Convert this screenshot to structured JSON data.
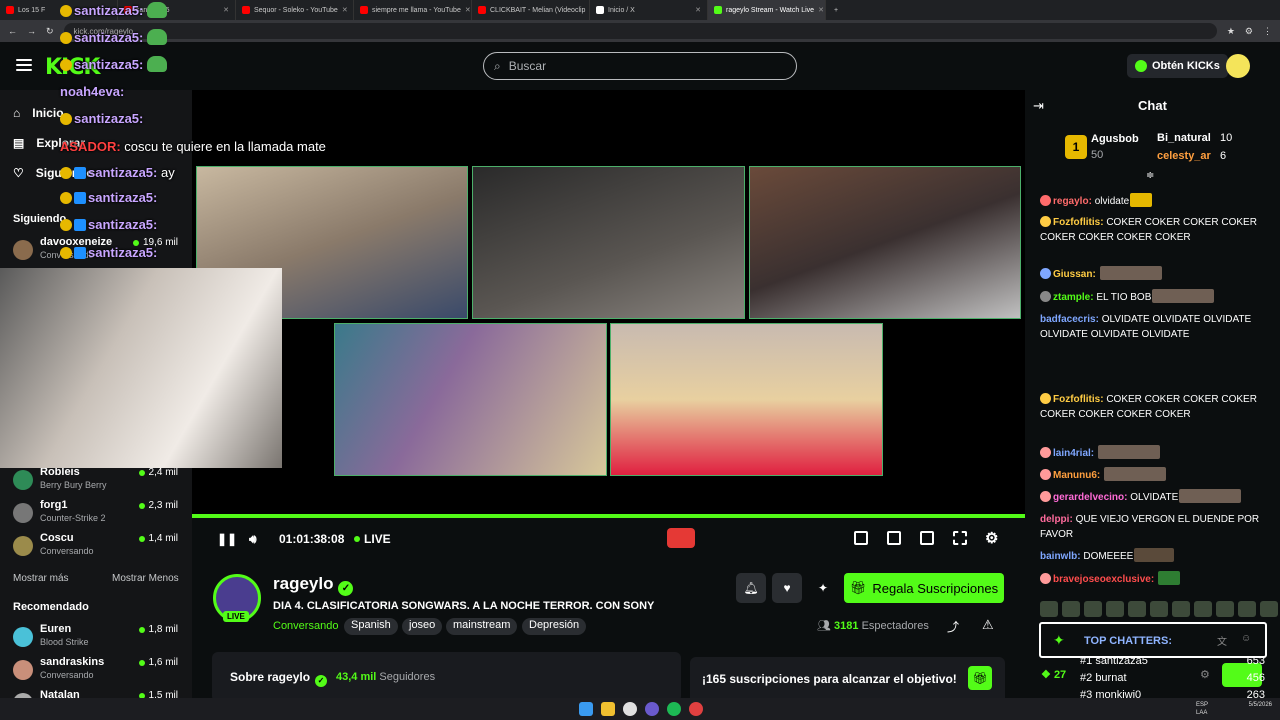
{
  "browser": {
    "tabs": [
      {
        "label": "Los 15 F",
        "color": "#ff0000"
      },
      {
        "label": "santizaza5",
        "color": "#ff0000"
      },
      {
        "label": "Sequor - Soleko - YouTube",
        "color": "#ff0000"
      },
      {
        "label": "siempre me llama - YouTube",
        "color": "#ff0000"
      },
      {
        "label": "CLICKBAIT - Melian (Videoclip",
        "color": "#ff0000"
      },
      {
        "label": "Inicio / X",
        "color": "#ffffff"
      },
      {
        "label": "rageylo Stream - Watch Live",
        "color": "#53fc18"
      }
    ],
    "url": "kick.com/rageylo"
  },
  "header": {
    "logo": "KICK",
    "search_placeholder": "Buscar",
    "get_kicks": "Obtén KICKs"
  },
  "sidebar": {
    "nav": [
      {
        "label": "Inicio"
      },
      {
        "label": "Explorar"
      },
      {
        "label": "Siguiendo"
      }
    ],
    "following_title": "Siguiendo",
    "following": [
      {
        "name": "davooxeneize",
        "game": "Conversando",
        "viewers": "19,6 mil",
        "color": "#8a6b4d"
      },
      {
        "name": "Robleis",
        "game": "Berry Bury Berry",
        "viewers": "2,4 mil",
        "color": "#2e8b57"
      },
      {
        "name": "forg1",
        "game": "Counter-Strike 2",
        "viewers": "2,3 mil",
        "color": "#777"
      },
      {
        "name": "Coscu",
        "game": "Conversando",
        "viewers": "1,4 mil",
        "color": "#9b8b4b"
      }
    ],
    "show_more": "Mostrar más",
    "show_less": "Mostrar Menos",
    "recommended_title": "Recomendado",
    "recommended": [
      {
        "name": "Euren",
        "game": "Blood Strike",
        "viewers": "1,8 mil",
        "color": "#4ac1d8"
      },
      {
        "name": "sandraskins",
        "game": "Conversando",
        "viewers": "1,6 mil",
        "color": "#c98f7a"
      },
      {
        "name": "Natalan",
        "game": "",
        "viewers": "1,5 mil",
        "color": "#aaa"
      }
    ]
  },
  "overlay_chat": [
    {
      "user": "santizaza5:",
      "msg": ""
    },
    {
      "user": "santizaza5:",
      "msg": ""
    },
    {
      "user": "santizaza5:",
      "msg": ""
    },
    {
      "user": "noah4eva:",
      "msg": ""
    },
    {
      "user": "santizaza5:",
      "msg": ""
    },
    {
      "user": "ASADOR:",
      "msg": "coscu te quiere en la llamada mate"
    },
    {
      "user": "santizaza5:",
      "msg": "ay"
    },
    {
      "user": "santizaza5:",
      "msg": ""
    },
    {
      "user": "santizaza5:",
      "msg": ""
    },
    {
      "user": "santizaza5:",
      "msg": ""
    }
  ],
  "player": {
    "time": "01:01:38:08",
    "live": "LIVE"
  },
  "stream": {
    "name": "rageylo",
    "live_badge": "LIVE",
    "title": "DIA 4. CLASIFICATORIA SONGWARS. A LA NOCHE TERROR. CON SONY",
    "category": "Conversando",
    "tags": [
      "Spanish",
      "joseo",
      "mainstream",
      "Depresión"
    ],
    "subs_button": "Regala Suscripciones",
    "viewers": "3181",
    "viewers_label": "Espectadores",
    "about_label": "Sobre rageylo",
    "followers": "43,4 mil",
    "followers_label": "Seguidores",
    "goal": "¡165 suscripciones para alcanzar el objetivo!"
  },
  "chat": {
    "title": "Chat",
    "gifters": [
      {
        "name": "Agusbob",
        "count": "50"
      },
      {
        "name": "Bi_natural",
        "count": "10"
      },
      {
        "name": "celesty_ar",
        "count": "6"
      }
    ],
    "messages": [
      {
        "user": "regaylo:",
        "text": "olvidate",
        "color": "#ff6b6b"
      },
      {
        "user": "Fozfoflitis:",
        "text": "COKER COKER COKER COKER COKER COKER COKER COKER",
        "color": "#ffcc44"
      },
      {
        "user": "Giussan:",
        "text": "",
        "color": "#ffcc44"
      },
      {
        "user": "ztample:",
        "text": "EL TIO BOB",
        "color": "#53fc18"
      },
      {
        "user": "badfacecris:",
        "text": "OLVIDATE OLVIDATE OLVIDATE OLVIDATE OLVIDATE OLVIDATE",
        "color": "#7fa7ff"
      },
      {
        "user": "Fozfoflitis:",
        "text": "COKER COKER COKER COKER COKER COKER COKER COKER",
        "color": "#ffcc44"
      },
      {
        "user": "lain4rial:",
        "text": "",
        "color": "#7fa7ff"
      },
      {
        "user": "Manunu6:",
        "text": "",
        "color": "#ff9f3f"
      },
      {
        "user": "gerardelvecino:",
        "text": "OLVIDATE",
        "color": "#ff6bd6"
      },
      {
        "user": "delppi:",
        "text": "QUE VIEJO VERGON EL DUENDE POR FAVOR",
        "color": "#ff6b9d"
      },
      {
        "user": "bainwlb:",
        "text": "DOMEEEE",
        "color": "#7fa7ff"
      },
      {
        "user": "bravejoseoexclusive:",
        "text": "",
        "color": "#ff4d4d"
      }
    ],
    "top_chatters_title": "TOP CHATTERS:",
    "top_chatters": [
      {
        "rank": "#1",
        "name": "santizaza5",
        "count": "653"
      },
      {
        "rank": "#2",
        "name": "burnat",
        "count": "456"
      },
      {
        "rank": "#3",
        "name": "monkiwi0",
        "count": "263"
      }
    ],
    "points": "27"
  },
  "taskbar": {
    "lang": "ESP",
    "lang2": "LAA",
    "date": "5/5/2026"
  },
  "colors": {
    "accent": "#53fc18",
    "bg": "#0b0e0f",
    "sidebar": "#141517"
  }
}
